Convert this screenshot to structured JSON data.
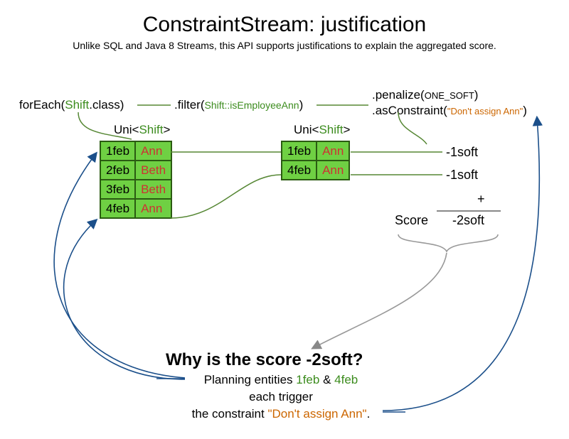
{
  "title": "ConstraintStream: justification",
  "subtitle": "Unlike SQL and Java 8 Streams, this API supports justifications to explain the aggregated score.",
  "code": {
    "forEach_pre": "forEach(",
    "forEach_type": "Shift",
    "forEach_post": ".class)",
    "filter_pre": ".filter(",
    "filter_lambda": "Shift::isEmployeeAnn",
    "filter_post": ")",
    "penalize_pre": ".penalize(",
    "penalize_const": "ONE_SOFT",
    "penalize_post": ")",
    "asConstraint_pre": ".asConstraint(",
    "asConstraint_str": "\"Don't assign Ann\"",
    "asConstraint_post": ")"
  },
  "uni_label_pre": "Uni<",
  "uni_label_type": "Shift",
  "uni_label_post": ">",
  "table_left": [
    {
      "date": "1feb",
      "name": "Ann"
    },
    {
      "date": "2feb",
      "name": "Beth"
    },
    {
      "date": "3feb",
      "name": "Beth"
    },
    {
      "date": "4feb",
      "name": "Ann"
    }
  ],
  "table_right": [
    {
      "date": "1feb",
      "name": "Ann"
    },
    {
      "date": "4feb",
      "name": "Ann"
    }
  ],
  "penalty1": "-1soft",
  "penalty2": "-1soft",
  "plus": "+",
  "score_label": "Score",
  "score_value": "-2soft",
  "why_heading": "Why is the score -2soft?",
  "explain_line1_pre": "Planning entities ",
  "explain_1feb": "1feb",
  "explain_amp": " & ",
  "explain_4feb": "4feb",
  "explain_line2": "each trigger",
  "explain_line3_pre": "the constraint ",
  "explain_constraint": "\"Don't assign Ann\"",
  "explain_line3_post": "."
}
